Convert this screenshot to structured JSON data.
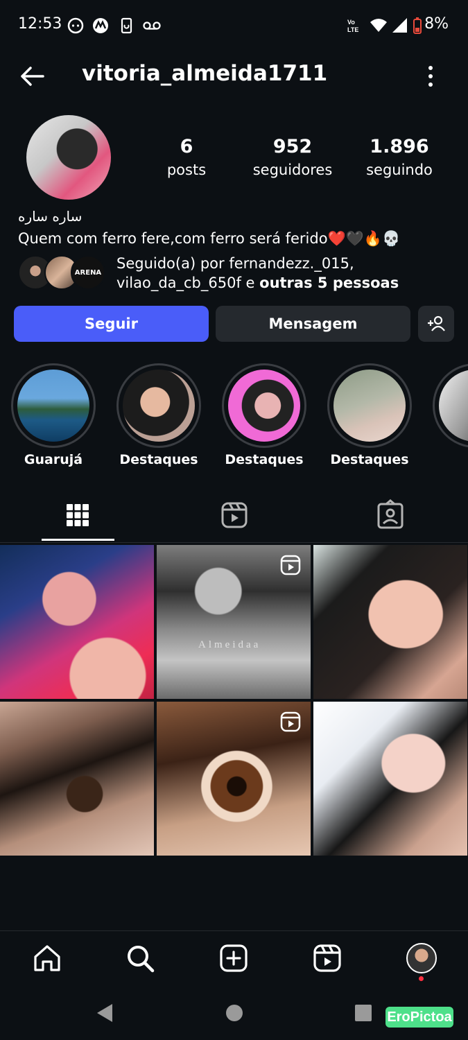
{
  "status_bar": {
    "time": "12:53",
    "battery": "8%",
    "icons": [
      "face-icon",
      "motorola-icon",
      "phone-sync-icon",
      "voicemail-icon",
      "volte-icon",
      "wifi-icon",
      "signal-icon",
      "battery-low-icon"
    ]
  },
  "header": {
    "username": "vitoria_almeida1711",
    "back_icon": "arrow-left-icon",
    "menu_icon": "more-vertical-icon"
  },
  "profile": {
    "stats": [
      {
        "value": "6",
        "label": "posts"
      },
      {
        "value": "952",
        "label": "seguidores"
      },
      {
        "value": "1.896",
        "label": "seguindo"
      }
    ],
    "full_name": "ساره ساره",
    "bio": "Quem com ferro fere,com ferro será ferido❤️🖤🔥💀",
    "followed_by_prefix": "Seguido(a) por fernandezz._015,",
    "followed_by_line2": "vilao_da_cb_650f e ",
    "followed_by_bold": "outras 5 pessoas",
    "followed_avatar_text": "ARENA"
  },
  "actions": {
    "follow": "Seguir",
    "message": "Mensagem",
    "add_user_icon": "add-person-icon",
    "accent": "#4a5df9"
  },
  "highlights": [
    {
      "label": "Guarujá"
    },
    {
      "label": "Destaques"
    },
    {
      "label": "Destaques"
    },
    {
      "label": "Destaques"
    }
  ],
  "tabs": [
    "grid-icon",
    "reels-icon",
    "tagged-icon"
  ],
  "posts": [
    {
      "overlay_text": ""
    },
    {
      "overlay_text": "Almeidaa"
    },
    {
      "overlay_text": ""
    },
    {
      "overlay_text": ""
    },
    {
      "overlay_text": ""
    },
    {
      "overlay_text": ""
    }
  ],
  "bottom_nav": [
    "home-icon",
    "search-icon",
    "create-icon",
    "reels-icon",
    "profile-avatar"
  ],
  "system_nav": [
    "back-triangle-icon",
    "home-circle-icon",
    "recents-square-icon"
  ],
  "watermark": "EroPictoa"
}
